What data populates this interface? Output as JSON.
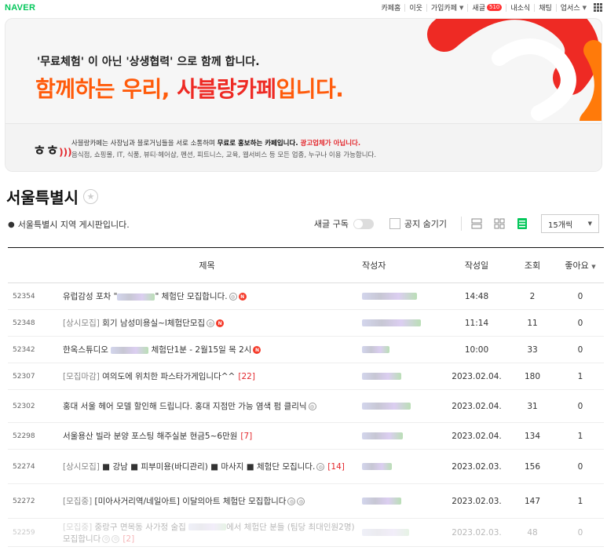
{
  "brand": {
    "logo": "NAVER"
  },
  "gnb": [
    {
      "label": "카페홈"
    },
    {
      "label": "이웃"
    },
    {
      "label": "가입카페",
      "caret": "▼"
    },
    {
      "label": "새글",
      "badge": "510"
    },
    {
      "label": "내소식"
    },
    {
      "label": "채팅"
    },
    {
      "label": "업서스",
      "caret": "▼"
    }
  ],
  "banner": {
    "line1": "'무료체험' 이 아닌 '상생협력' 으로 함께 합니다.",
    "line2_a": "함께하는 우리, ",
    "line2_b": "사블랑카페",
    "line2_c": "입니다.",
    "logo_text": "ㅎㅎ",
    "desc1_a": "사블랑카페는 사장님과 블로거님들을 서로 소통하며 ",
    "desc1_b": "무료로 홍보하는 카페입니다.",
    "desc1_c": " 광고업체가 아닙니다.",
    "desc2": "음식점, 쇼핑몰, IT, 식품, 뷰티·헤어샵, 펜션, 피트니스, 교육, 웹서비스 등 모든 업종, 누구나 이용 가능합니다.",
    "colors": {
      "accent": "#ff5b0b",
      "red": "#ee2a24",
      "yellow": "#ffb900"
    }
  },
  "board": {
    "title": "서울특별시",
    "desc": "서울특별시 지역 게시판입니다.",
    "subscribe_label": "새글 구독",
    "hide_notice_label": "공지 숨기기",
    "page_size": "15개씩"
  },
  "table": {
    "headers": {
      "title": "제목",
      "author": "작성자",
      "date": "작성일",
      "views": "조회",
      "likes": "좋아요",
      "likes_caret": "▼"
    },
    "rows": [
      {
        "no": "52354",
        "prefix": "",
        "title": "유럽감성 포차 \"",
        "title2": "\" 체험단 모집합니다.",
        "icons": [
          "gi",
          "ni"
        ],
        "comments": "",
        "date": "14:48",
        "views": "2",
        "likes": "0"
      },
      {
        "no": "52348",
        "prefix": "[상시모집]",
        "title": " 회기 남성미용실~l체험단모집",
        "title2": "",
        "icons": [
          "gi",
          "ni"
        ],
        "comments": "",
        "date": "11:14",
        "views": "11",
        "likes": "0"
      },
      {
        "no": "52342",
        "prefix": "",
        "title": "한옥스튜디오 ",
        "title2": " 체험단1분 - 2월15일 목 2시",
        "icons": [
          "ni"
        ],
        "comments": "",
        "date": "10:00",
        "views": "33",
        "likes": "0"
      },
      {
        "no": "52307",
        "prefix": "[모집마감]",
        "title": " 여의도에 위치한 파스타가게입니다^^",
        "title2": "",
        "icons": [],
        "comments": "[22]",
        "date": "2023.02.04.",
        "views": "180",
        "likes": "1"
      },
      {
        "no": "52302",
        "prefix": "",
        "title": "홍대 서울 헤어 모델 할인해 드립니다. 홍대 지점만 가능 염색 펌 클리닉",
        "title2": "",
        "icons": [
          "gi"
        ],
        "comments": "",
        "date": "2023.02.04.",
        "views": "31",
        "likes": "0"
      },
      {
        "no": "52298",
        "prefix": "",
        "title": "서울용산 빌라 분양 포스팅 해주실분 현금5~6만원",
        "title2": "",
        "icons": [],
        "comments": "[7]",
        "date": "2023.02.04.",
        "views": "134",
        "likes": "1"
      },
      {
        "no": "52274",
        "prefix": "[상시모집]",
        "title": " ■ 강남 ■ 피부미용(바디관리) ■ 마사지 ■ 체험단 모집니다.",
        "title2": "",
        "icons": [
          "gi"
        ],
        "comments": "[14]",
        "date": "2023.02.03.",
        "views": "156",
        "likes": "0"
      },
      {
        "no": "52272",
        "prefix": "[모집중]",
        "title": " [미아사거리역/네일아트] 이달의아트 체험단 모집합니다",
        "title2": "",
        "icons": [
          "gi",
          "gi"
        ],
        "comments": "",
        "date": "2023.02.03.",
        "views": "147",
        "likes": "1"
      },
      {
        "no": "52259",
        "prefix": "[모집중]",
        "title": " 중랑구 면목동 사가정 술집 ",
        "title2": "에서 체험단 분들 (팀당 최대인원2명) 모집합니다",
        "icons": [
          "gi",
          "gi"
        ],
        "comments": "[2]",
        "date": "2023.02.03.",
        "views": "48",
        "likes": "0"
      }
    ]
  }
}
